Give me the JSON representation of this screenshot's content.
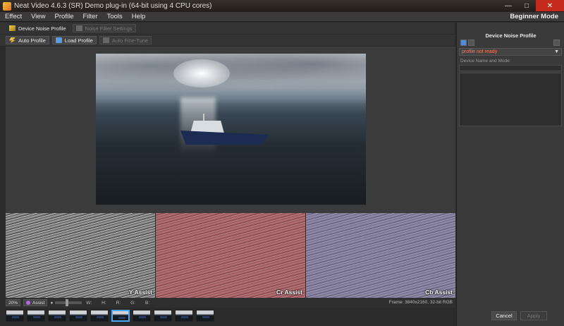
{
  "window": {
    "title": "Neat Video 4.6.3 (SR) Demo plug-in (64-bit using 4 CPU cores)"
  },
  "menu": {
    "items": [
      "Effect",
      "View",
      "Profile",
      "Filter",
      "Tools",
      "Help"
    ],
    "mode": "Beginner Mode"
  },
  "toolbar": {
    "device_noise_profile": "Device Noise Profile",
    "noise_filter_settings": "Noise Filter Settings",
    "auto_profile": "Auto Profile",
    "load_profile": "Load Profile",
    "auto_fine_tune": "Auto Fine-Tune"
  },
  "assist": {
    "y": "Y Assist",
    "cr": "Cr Assist",
    "cb": "Cb Assist"
  },
  "status": {
    "zoom": "20%",
    "assist": "Assist",
    "w": "W:",
    "h": "H:",
    "r": "R:",
    "g": "G:",
    "b": "B:",
    "frame": "Frame: 3840x2160, 32-bit RGB"
  },
  "side_panel": {
    "title": "Device Noise Profile",
    "profile_status": "profile not ready",
    "device_label": "Device Name and Mode:"
  },
  "buttons": {
    "cancel": "Cancel",
    "apply": "Apply"
  },
  "colors": {
    "accent": "#4aa8ff",
    "warning": "#ff7a5a",
    "close": "#c42b1c"
  }
}
